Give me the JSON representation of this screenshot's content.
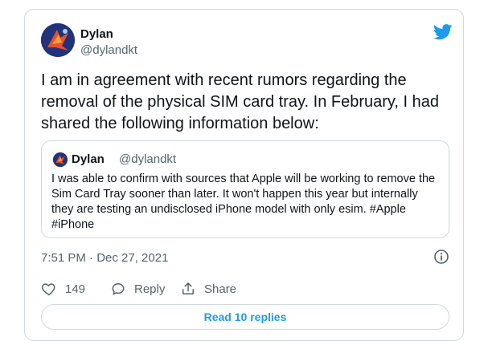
{
  "tweet": {
    "author": {
      "name": "Dylan",
      "handle": "@dylandkt"
    },
    "text": "I am in agreement with recent rumors regarding the removal of the physical SIM card tray. In February, I had shared the following information below:",
    "quoted": {
      "name": "Dylan",
      "handle": "@dylandkt",
      "text": "I was able to confirm with sources that Apple will be working to remove the Sim Card Tray sooner than later. It won't happen this year but internally they are testing an undisclosed iPhone model with only esim. #Apple #iPhone"
    },
    "timestamp": "7:51 PM · Dec 27, 2021",
    "likes": "149",
    "reply_label": "Reply",
    "share_label": "Share",
    "read_replies_label": "Read 10 replies"
  },
  "colors": {
    "accent": "#1d9bf0",
    "text": "#0f1419",
    "muted": "#536471",
    "border": "#cfd9de"
  },
  "icons": {
    "brand": "twitter-bird-icon",
    "info": "info-icon",
    "like": "heart-icon",
    "reply": "speech-bubble-icon",
    "share": "share-icon"
  }
}
